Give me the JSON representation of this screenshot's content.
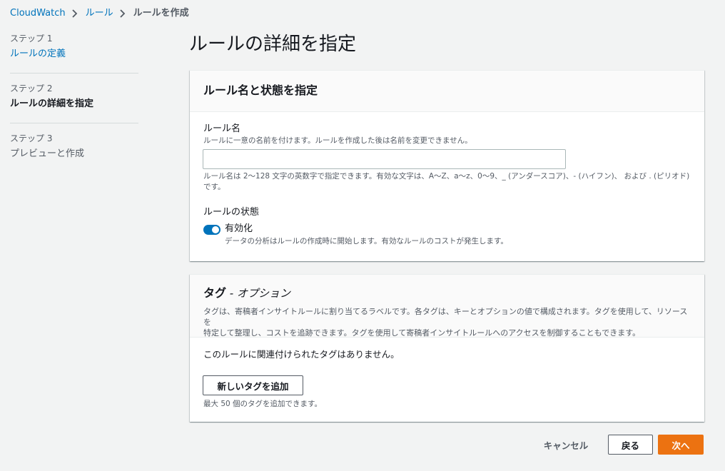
{
  "breadcrumb": {
    "items": [
      "CloudWatch",
      "ルール"
    ],
    "current": "ルールを作成"
  },
  "steps": [
    {
      "number": "ステップ 1",
      "label": "ルールの定義",
      "state": "link"
    },
    {
      "number": "ステップ 2",
      "label": "ルールの詳細を指定",
      "state": "active"
    },
    {
      "number": "ステップ 3",
      "label": "プレビューと作成",
      "state": "disabled"
    }
  ],
  "page": {
    "title": "ルールの詳細を指定"
  },
  "rule_panel": {
    "title": "ルール名と状態を指定",
    "name_label": "ルール名",
    "name_description": "ルールに一意の名前を付けます。ルールを作成した後は名前を変更できません。",
    "name_value": "",
    "name_placeholder": "",
    "name_constraint_line1": "ルール名は 2〜128 文字の英数字で指定できます。有効な文字は、A〜Z、a〜z、0〜9、_ (アンダースコア)、- (ハイフン)、 および . (ピリオド)",
    "name_constraint_line2": "です。",
    "state_label": "ルールの状態",
    "toggle_label": "有効化",
    "toggle_on": true,
    "toggle_description": "データの分析はルールの作成時に開始します。有効なルールのコストが発生します。"
  },
  "tags_panel": {
    "title": "タグ",
    "title_suffix": " - オプション",
    "description_line1": "タグは、寄稿者インサイトルールに割り当てるラベルです。各タグは、キーとオプションの値で構成されます。タグを使用して、リソースを",
    "description_line2": "特定して整理し、コストを追跡できます。タグを使用して寄稿者インサイトルールへのアクセスを制御することもできます。",
    "empty_message": "このルールに関連付けられたタグはありません。",
    "add_button": "新しいタグを追加",
    "limit_hint": "最大 50 個のタグを追加できます。"
  },
  "footer": {
    "cancel": "キャンセル",
    "back": "戻る",
    "next": "次へ"
  },
  "colors": {
    "link": "#0073bb",
    "primary": "#ec7211",
    "background": "#f2f3f3"
  }
}
